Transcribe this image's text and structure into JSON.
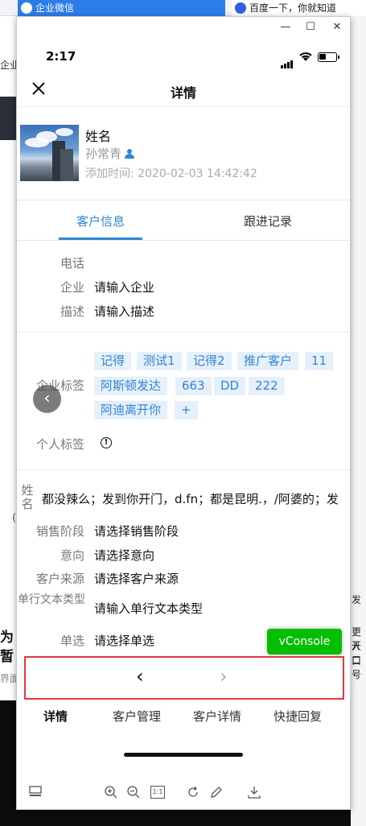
{
  "browser": {
    "tabs": [
      {
        "label": "企业微信"
      },
      {
        "label": "百度一下，你就知道"
      }
    ],
    "left_fragments": [
      "企业",
      "为",
      "暂",
      "界面",
      "("
    ],
    "right_fragments": [
      "发",
      "更开",
      "人口",
      "口号"
    ]
  },
  "window_controls": {
    "minimize": "—",
    "maximize": "☐",
    "close": "✕"
  },
  "statusbar": {
    "time": "2:17"
  },
  "navbar": {
    "title": "详情",
    "close_icon": "close-icon"
  },
  "profile": {
    "name": "姓名",
    "owner": "孙常青",
    "created": "添加时间: 2020-02-03 14:42:42"
  },
  "tabs": [
    {
      "label": "客户信息",
      "active": true
    },
    {
      "label": "跟进记录",
      "active": false
    }
  ],
  "fields_basic": [
    {
      "label": "电话",
      "value": ""
    },
    {
      "label": "企业",
      "value": "请输入企业"
    },
    {
      "label": "描述",
      "value": "请输入描述"
    }
  ],
  "tags": {
    "enterprise_label": "企业标签",
    "enterprise_tags": [
      "记得",
      "测试1",
      "记得2",
      "推广客户",
      "11",
      "阿斯顿发达",
      "663",
      "DD",
      "222",
      "阿迪离开你",
      "+"
    ],
    "personal_label": "个人标签"
  },
  "long_field": {
    "label": "姓名",
    "value": "都没辣么；发到你开门，d.fn；都是昆明.，/阿婆的；发"
  },
  "fields_more": [
    {
      "label": "销售阶段",
      "value": "请选择销售阶段"
    },
    {
      "label": "意向",
      "value": "请选择意向"
    },
    {
      "label": "客户来源",
      "value": "请选择客户来源"
    },
    {
      "label": "单行文本类型",
      "value": "请输入单行文本类型"
    },
    {
      "label": "单选",
      "value": "请选择单选"
    }
  ],
  "vconsole": {
    "label": "vConsole"
  },
  "history_nav": {
    "back": "‹",
    "forward": "›"
  },
  "bottom_tabs": [
    {
      "label": "详情",
      "active": true
    },
    {
      "label": "客户管理",
      "active": false
    },
    {
      "label": "客户详情",
      "active": false
    },
    {
      "label": "快捷回复",
      "active": false
    }
  ],
  "devtools": {
    "icons": [
      "layout-icon",
      "zoom-in-icon",
      "zoom-out-icon",
      "actual-size-icon",
      "rotate-icon",
      "edit-icon",
      "download-icon"
    ],
    "actual_size_label": "1:1"
  },
  "colors": {
    "accent": "#2f86d6",
    "tag_bg": "#e6f0fb",
    "vconsole": "#04be02",
    "highlight": "#e0393e"
  }
}
